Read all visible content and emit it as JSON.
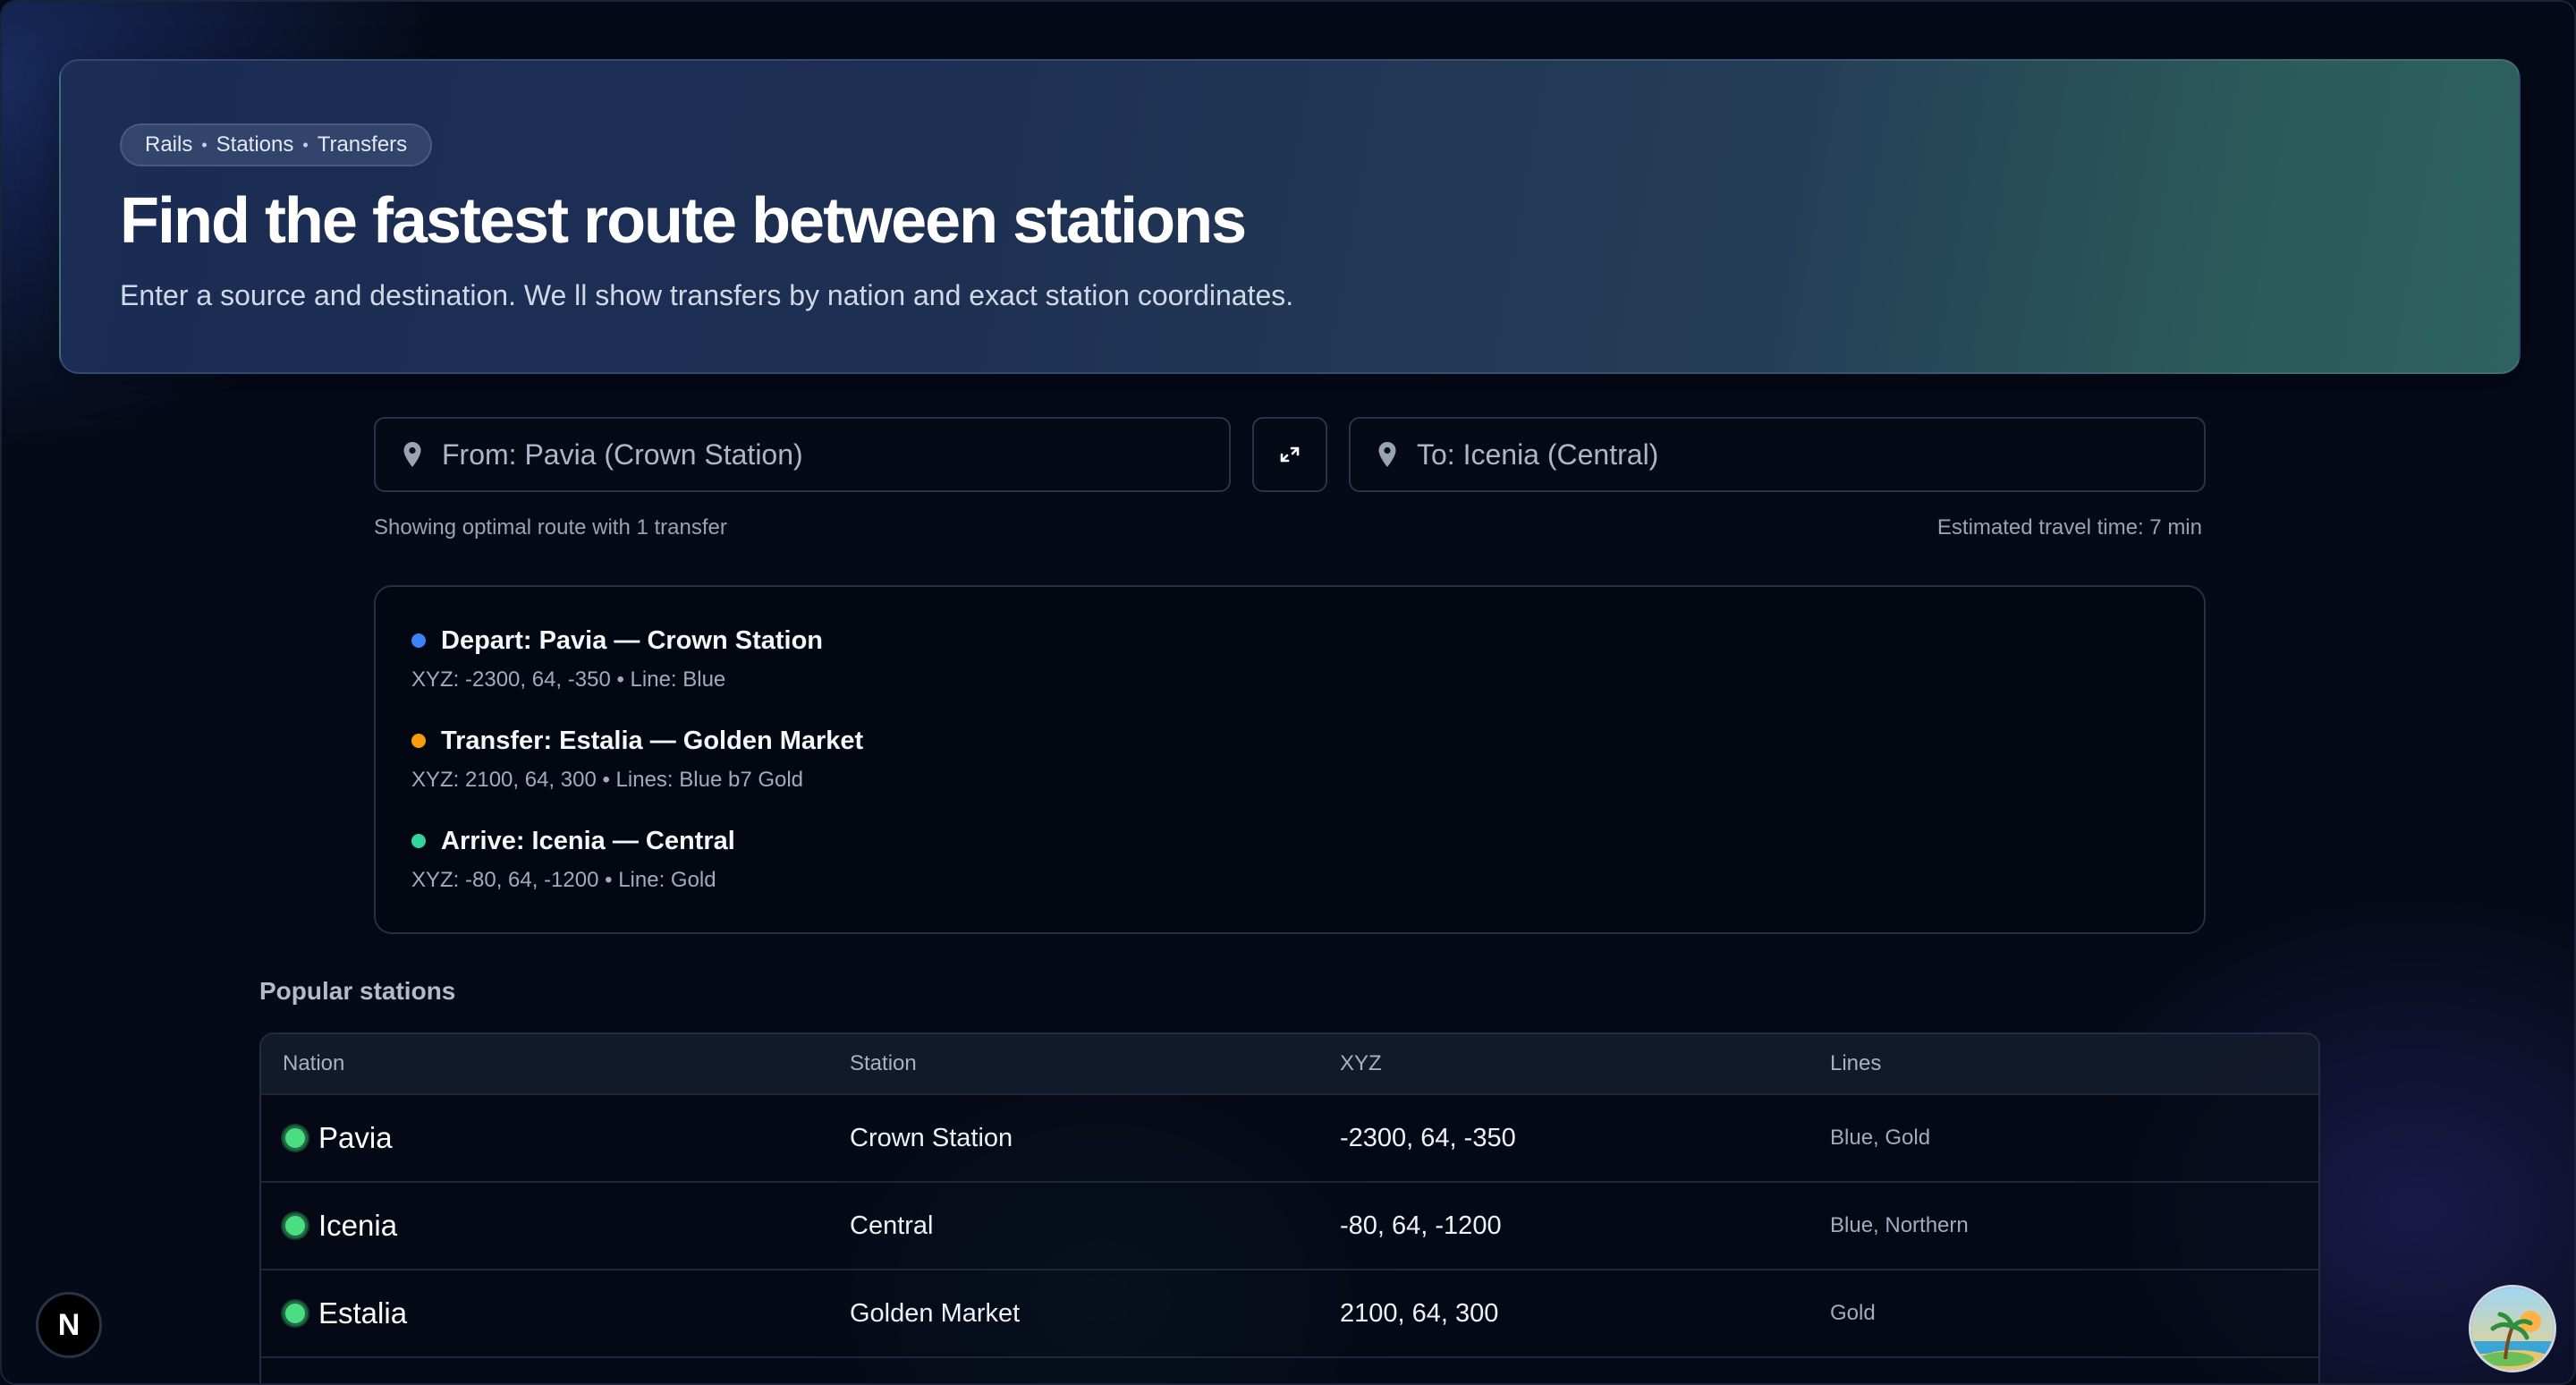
{
  "hero": {
    "breadcrumb": [
      "Rails",
      "Stations",
      "Transfers"
    ],
    "breadcrumb_separator": "•",
    "title": "Find the fastest route between stations",
    "subtitle": "Enter a source and destination. We ll show transfers by nation and exact station coordinates."
  },
  "search": {
    "from_placeholder": "From: Pavia (Crown Station)",
    "to_placeholder": "To: Icenia (Central)",
    "swap_icon": "swap-arrows-icon",
    "pin_icon": "map-pin-icon"
  },
  "route": {
    "summary": "Showing optimal route with 1 transfer",
    "estimate": "Estimated travel time: 7 min",
    "stops": [
      {
        "title": "Depart: Pavia — Crown Station",
        "detail": "XYZ: -2300, 64, -350 • Line: Blue",
        "color": "#3b82f6"
      },
      {
        "title": "Transfer: Estalia — Golden Market",
        "detail": "XYZ: 2100, 64, 300 • Lines: Blue b7 Gold",
        "color": "#f59e0b"
      },
      {
        "title": "Arrive: Icenia — Central",
        "detail": "XYZ: -80, 64, -1200 • Line: Gold",
        "color": "#34d399"
      }
    ]
  },
  "popular": {
    "title": "Popular stations",
    "columns": [
      "Nation",
      "Station",
      "XYZ",
      "Lines"
    ],
    "rows": [
      {
        "nation": "Pavia",
        "station": "Crown Station",
        "xyz": "-2300, 64, -350",
        "lines": "Blue, Gold"
      },
      {
        "nation": "Icenia",
        "station": "Central",
        "xyz": "-80, 64, -1200",
        "lines": "Blue, Northern"
      },
      {
        "nation": "Estalia",
        "station": "Golden Market",
        "xyz": "2100, 64, 300",
        "lines": "Gold"
      }
    ]
  },
  "floating": {
    "dev_badge": "N",
    "avatar_icon": "beach-avatar-icon"
  },
  "colors": {
    "accent_blue": "#3b82f6",
    "accent_amber": "#f59e0b",
    "accent_green": "#4ade80"
  }
}
